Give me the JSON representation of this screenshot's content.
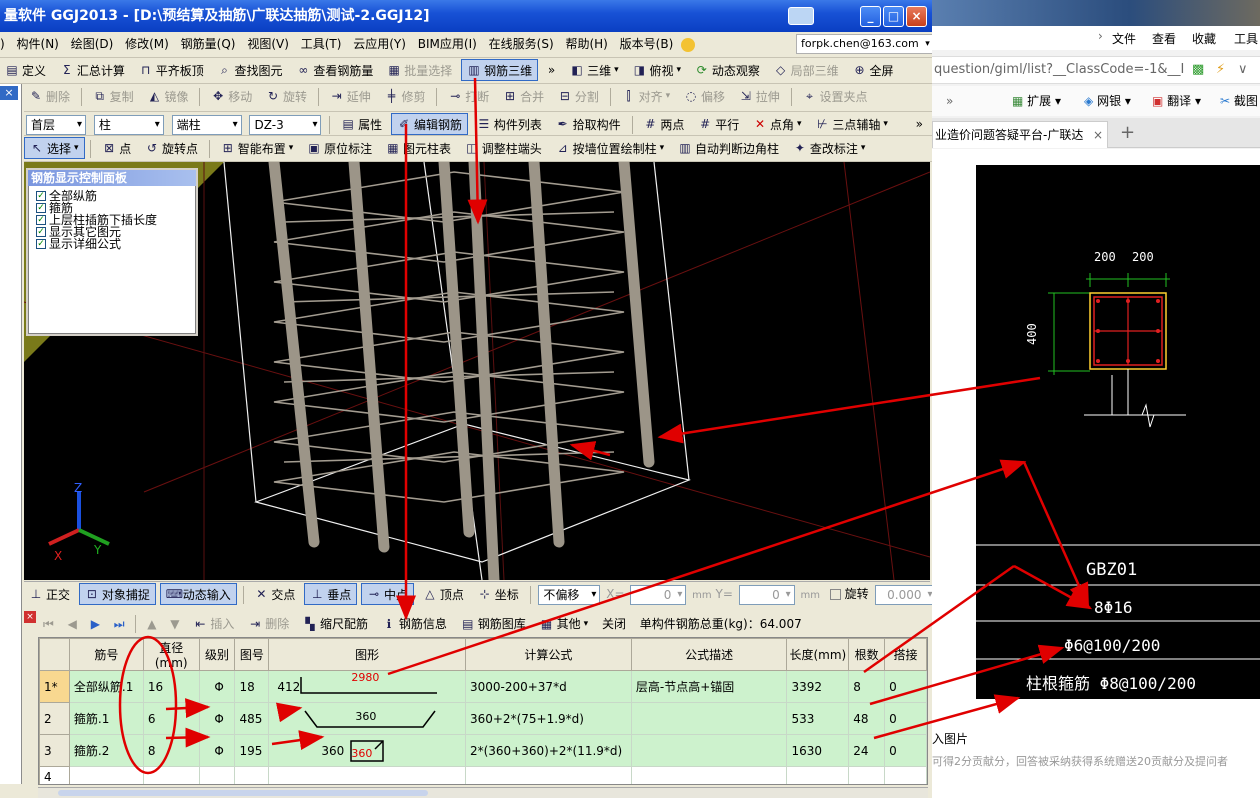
{
  "window": {
    "title": "量软件 GGJ2013 - [D:\\预结算及抽筋\\广联达抽筋\\测试-2.GGJ12]",
    "min": "_",
    "max": "□",
    "close": "×"
  },
  "menu": {
    "items": [
      "构件(N)",
      "绘图(D)",
      "修改(M)",
      "钢筋量(Q)",
      "视图(V)",
      "工具(T)",
      "云应用(Y)",
      "BIM应用(I)",
      "在线服务(S)",
      "帮助(H)",
      "版本号(B)"
    ],
    "prefix": ")",
    "account": "forpk.chen@163.com"
  },
  "toolbar1": {
    "define": "定义",
    "summary": "汇总计算",
    "flat_top": "平齐板顶",
    "find_element": "查找图元",
    "view_rebar": "查看钢筋量",
    "batch_select": "批量选择",
    "rebar_3d": "钢筋三维",
    "view_3d": "三维",
    "top_view": "俯视",
    "dynamic_view": "动态观察",
    "local_3d": "局部三维",
    "fullscreen": "全屏"
  },
  "toolbar2": {
    "delete": "删除",
    "copy": "复制",
    "mirror": "镜像",
    "move": "移动",
    "rotate": "旋转",
    "extend": "延伸",
    "trim": "修剪",
    "break": "打断",
    "merge": "合并",
    "split": "分割",
    "align": "对齐",
    "offset": "偏移",
    "stretch": "拉伸",
    "set_point": "设置夹点"
  },
  "toolbar3": {
    "floor": "首层",
    "type": "柱",
    "subtype": "端柱",
    "element": "DZ-3",
    "properties": "属性",
    "edit_rebar": "编辑钢筋",
    "element_list": "构件列表",
    "pick_element": "拾取构件",
    "two_points": "两点",
    "parallel": "平行",
    "point_angle": "点角",
    "three_point_aux": "三点辅轴"
  },
  "toolbar4": {
    "select": "选择",
    "point": "点",
    "rotate_point": "旋转点",
    "smart_layout": "智能布置",
    "in_place_mark": "原位标注",
    "element_column_table": "图元柱表",
    "adjust_column_end": "调整柱端头",
    "draw_by_wall": "按墙位置绘制柱",
    "auto_corner": "自动判断边角柱",
    "check_mark": "查改标注"
  },
  "control_panel": {
    "title": "钢筋显示控制面板",
    "options": [
      "全部纵筋",
      "箍筋",
      "上层柱插筋下插长度",
      "显示其它图元",
      "显示详细公式"
    ]
  },
  "axis": {
    "x": "X",
    "y": "Y",
    "z": "Z"
  },
  "snap_bar": {
    "ortho": "正交",
    "object_snap": "对象捕捉",
    "dynamic_input": "动态输入",
    "intersection": "交点",
    "perpendicular": "垂点",
    "midpoint": "中点",
    "vertex": "顶点",
    "coordinate": "坐标",
    "no_offset": "不偏移",
    "x_label": "X=",
    "x_value": "0",
    "mm1": "mm",
    "y_label": "Y=",
    "y_value": "0",
    "mm2": "mm",
    "rotate": "旋转",
    "rotate_value": "0.000",
    "degree": "°"
  },
  "info_bar": {
    "insert": "插入",
    "delete": "删除",
    "scale_rebar": "缩尺配筋",
    "rebar_info": "钢筋信息",
    "rebar_library": "钢筋图库",
    "other": "其他",
    "close": "关闭",
    "total_weight": "单构件钢筋总重(kg)：64.007"
  },
  "grid": {
    "headers": [
      "",
      "筋号",
      "直径(mm)",
      "级别",
      "图号",
      "图形",
      "计算公式",
      "公式描述",
      "长度(mm)",
      "根数",
      "搭接"
    ],
    "rows": [
      {
        "no": "1*",
        "name": "全部纵筋.1",
        "dia": "16",
        "grade": "Φ",
        "fig": "18",
        "shape_left": "412",
        "shape_top": "2980",
        "shape_right": "",
        "formula": "3000-200+37*d",
        "desc": "层高-节点高+锚固",
        "length": "3392",
        "count": "8",
        "lap": "0"
      },
      {
        "no": "2",
        "name": "箍筋.1",
        "dia": "6",
        "grade": "Φ",
        "fig": "485",
        "shape_left": "",
        "shape_top": "",
        "shape_mid": "360",
        "formula": "360+2*(75+1.9*d)",
        "desc": "",
        "length": "533",
        "count": "48",
        "lap": "0"
      },
      {
        "no": "3",
        "name": "箍筋.2",
        "dia": "8",
        "grade": "Φ",
        "fig": "195",
        "shape_left": "360",
        "shape_mid": "360",
        "formula": "2*(360+360)+2*(11.9*d)",
        "desc": "",
        "length": "1630",
        "count": "24",
        "lap": "0"
      },
      {
        "no": "4",
        "name": "",
        "dia": "",
        "grade": "",
        "fig": "",
        "formula": "",
        "desc": "",
        "length": "",
        "count": "",
        "lap": ""
      }
    ]
  },
  "browser": {
    "menu": {
      "file": "文件",
      "view": "查看",
      "fav": "收藏",
      "tools": "工具"
    },
    "url": "question/giml/list?__ClassCode=-1&__I",
    "fav": {
      "ext": "扩展",
      "bank": "网银",
      "translate": "翻译",
      "shot": "截图"
    },
    "tab_title": "业造价问题答疑平台-广联达",
    "cad": {
      "dim1": "200",
      "dim2": "200",
      "dim_side": "400",
      "name": "GBZ01",
      "main_rebar": "8Φ16",
      "stirrup": "Φ6@100/200",
      "root_stirrup": "柱根箍筋 Φ8@100/200"
    },
    "fig_link": "入图片",
    "bottom_text": "可得2分贡献分，回答被采纳获得系统赠送20贡献分及提问者"
  },
  "colors": {
    "annotation_red": "#e00000",
    "viewport_bg": "#000000",
    "slab_yellow": "#7a7a1a",
    "rebar": "#9c9588",
    "row_green": "#cdf2cd"
  }
}
